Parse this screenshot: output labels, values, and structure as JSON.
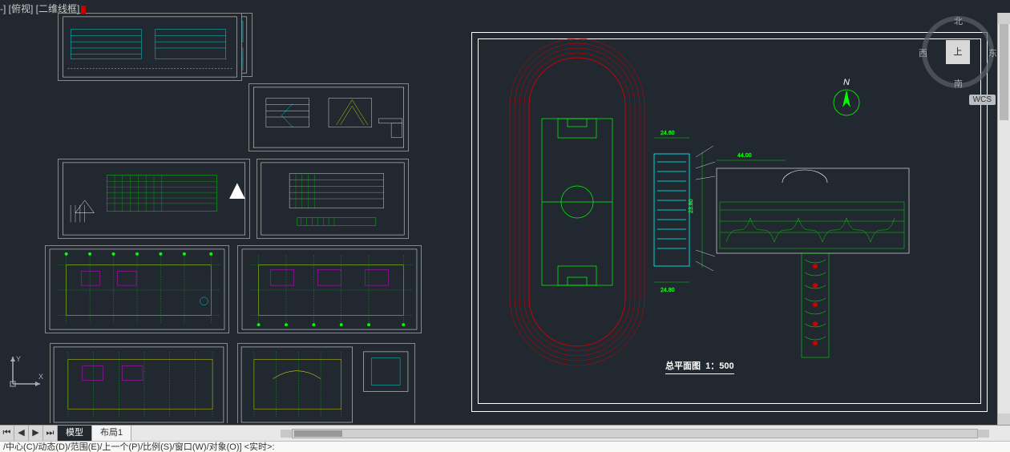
{
  "viewport_label": "-] [俯视] [二维线框]",
  "viewcube": {
    "top": "上",
    "n": "北",
    "s": "南",
    "e": "东",
    "w": "西"
  },
  "wcs": "WCS",
  "site_plan": {
    "title": "总平面图",
    "scale": "1：500",
    "dims": {
      "d1": "24.60",
      "d2": "24.80",
      "d3": "44.00",
      "d4": "23.80"
    },
    "north": "N"
  },
  "tabs": {
    "model": "模型",
    "layout1": "布局1"
  },
  "nav": {
    "first": "⏮",
    "prev": "◀",
    "next": "▶",
    "last": "⏭"
  },
  "cmdline": "/中心(C)/动态(D)/范围(E)/上一个(P)/比例(S)/窗口(W)/对象(O)] <实时>:",
  "ucs_labels": {
    "x": "X",
    "y": "Y"
  }
}
